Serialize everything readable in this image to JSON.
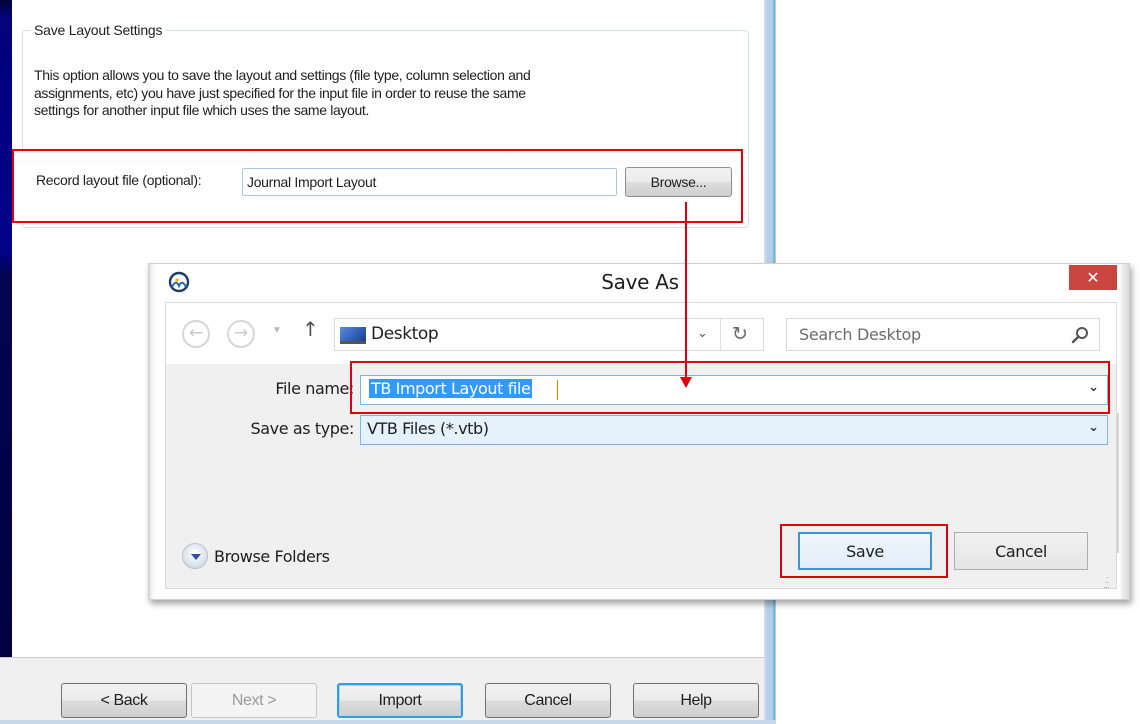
{
  "wizard": {
    "group_title": "Save Layout Settings",
    "description": "This option allows you to save the layout and settings (file type, column selection and assignments, etc) you have just specified for the input file in order to reuse the same settings for another input file which uses the same layout.",
    "record_label": "Record layout file (optional):",
    "record_value": "Journal Import Layout",
    "browse_label": "Browse...",
    "buttons": {
      "back": "< Back",
      "next": "Next >",
      "import": "Import",
      "cancel": "Cancel",
      "help": "Help"
    }
  },
  "save_as": {
    "title": "Save As",
    "close_label": "✕",
    "nav": {
      "back_icon": "←",
      "forward_icon": "→",
      "recent_icon": "▼",
      "up_icon": "↑",
      "location": "Desktop",
      "dropdown_icon": "⌄",
      "refresh_icon": "↻"
    },
    "search_placeholder": "Search Desktop",
    "file_name_label": "File name:",
    "file_name_value": "TB  Import Layout file",
    "save_type_label": "Save as type:",
    "save_type_value": "VTB Files (*.vtb)",
    "browse_folders_label": "Browse Folders",
    "save_label": "Save",
    "cancel_label": "Cancel"
  },
  "annotations": {
    "highlight_color": "#e0000c"
  }
}
